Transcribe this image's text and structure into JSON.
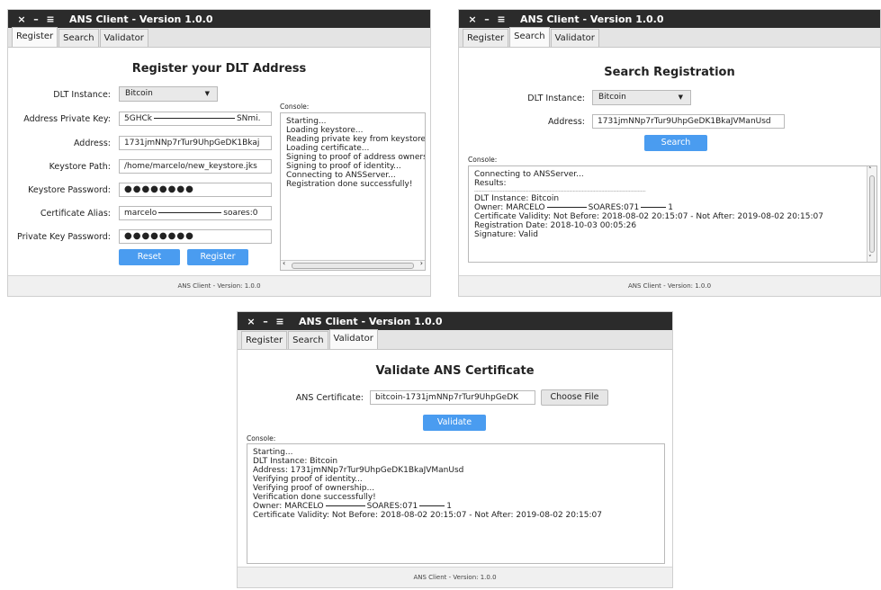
{
  "window_controls": {
    "close": "×",
    "minimize": "–",
    "menu": "≡"
  },
  "window_title": "ANS Client - Version 1.0.0",
  "footer_text": "ANS Client - Version: 1.0.0",
  "tabs": [
    "Register",
    "Search",
    "Validator"
  ],
  "register": {
    "heading": "Register your DLT Address",
    "labels": {
      "dlt_instance": "DLT Instance:",
      "private_key": "Address Private Key:",
      "address": "Address:",
      "keystore_path": "Keystore Path:",
      "keystore_password": "Keystore Password:",
      "cert_alias": "Certificate Alias:",
      "private_key_password": "Private Key Password:"
    },
    "values": {
      "dlt_instance": "Bitcoin",
      "private_key_start": "5GHCk",
      "private_key_end": "SNmi.",
      "address": "1731jmNNp7rTur9UhpGeDK1Bkaj",
      "keystore_path": "/home/marcelo/new_keystore.jks",
      "keystore_password": "●●●●●●●●",
      "cert_alias_start": "marcelo",
      "cert_alias_end": "soares:0",
      "private_key_password": "●●●●●●●●"
    },
    "buttons": {
      "reset": "Reset",
      "register": "Register"
    },
    "console_label": "Console:",
    "console_lines": [
      "Starting...",
      "Loading keystore...",
      "Reading private key from keystore",
      "Loading certificate...",
      "Signing to proof of address owners",
      "Signing to proof of identity...",
      "Connecting to ANSServer...",
      "Registration done successfully!"
    ]
  },
  "search": {
    "heading": "Search Registration",
    "labels": {
      "dlt_instance": "DLT Instance:",
      "address": "Address:"
    },
    "values": {
      "dlt_instance": "Bitcoin",
      "address": "1731jmNNp7rTur9UhpGeDK1BkaJVManUsd"
    },
    "button": "Search",
    "console_label": "Console:",
    "console_lines_top": [
      "Connecting to ANSServer...",
      "Results:"
    ],
    "separator": "------------------------------------------------------------------------------------------------------------------------------------",
    "dlt_line": "DLT Instance: Bitcoin",
    "owner_prefix": "Owner: MARCELO",
    "owner_mid": "SOARES:071",
    "owner_end": "1",
    "console_lines_bottom": [
      "Certificate Validity: Not Before: 2018-08-02 20:15:07 - Not After: 2019-08-02 20:15:07",
      "Registration Date: 2018-10-03 00:05:26",
      "Signature: Valid"
    ]
  },
  "validator": {
    "heading": "Validate ANS Certificate",
    "label": "ANS Certificate:",
    "value": "bitcoin-1731jmNNp7rTur9UhpGeDK",
    "choose_file": "Choose File",
    "button": "Validate",
    "console_label": "Console:",
    "console_lines_top": [
      "Starting...",
      "DLT Instance: Bitcoin",
      "Address: 1731jmNNp7rTur9UhpGeDK1BkaJVManUsd",
      "Verifying proof of identity...",
      "Verifying proof of ownership...",
      "Verification done successfully!"
    ],
    "owner_prefix": "Owner: MARCELO",
    "owner_mid": "SOARES:071",
    "owner_end": "1",
    "validity_line": "Certificate Validity: Not Before: 2018-08-02 20:15:07 - Not After: 2019-08-02 20:15:07"
  }
}
